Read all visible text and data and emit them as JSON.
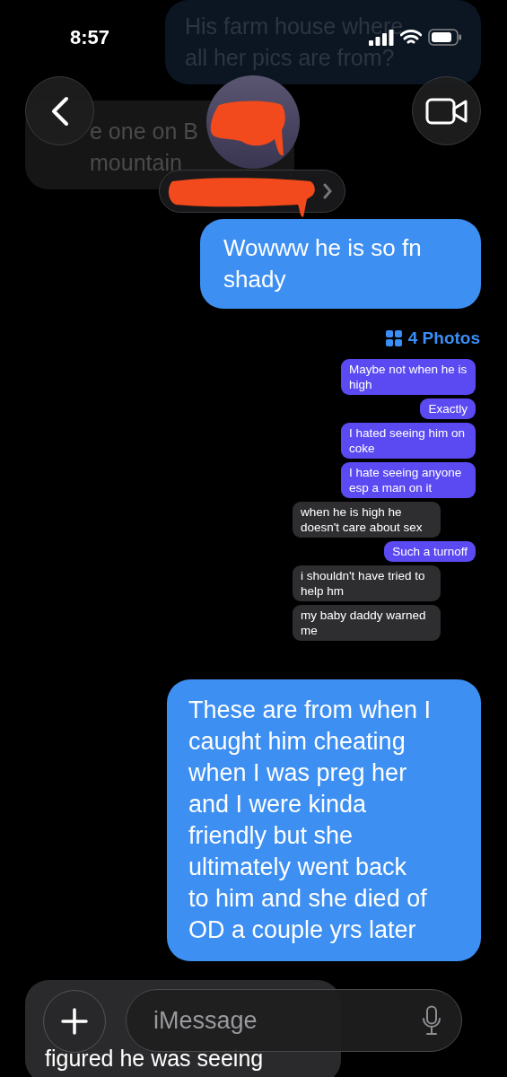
{
  "status_bar": {
    "time": "8:57"
  },
  "messages": [
    {
      "kind": "text",
      "outgoing": true,
      "dimmed": true,
      "lines": [
        "His farm house where",
        "all her pics are from?"
      ]
    },
    {
      "kind": "text",
      "outgoing": false,
      "dimmed": true,
      "lines": [
        "e one on B",
        "mountain"
      ]
    },
    {
      "kind": "text",
      "outgoing": true,
      "dimmed": false,
      "lines": [
        "Wowww he is so fn",
        "shady"
      ]
    },
    {
      "kind": "photos",
      "label": "4 Photos",
      "messages": [
        {
          "outgoing": true,
          "text": "Maybe not when he is high"
        },
        {
          "outgoing": true,
          "text": "Exactly"
        },
        {
          "outgoing": true,
          "text": "I hated seeing him on coke"
        },
        {
          "outgoing": true,
          "text": "I hate seeing anyone esp a man on it"
        },
        {
          "outgoing": false,
          "text": "when he is high he doesn't care about sex"
        },
        {
          "outgoing": true,
          "text": "Such a turnoff"
        },
        {
          "outgoing": false,
          "text": "i shouldn't have tried to help hm"
        },
        {
          "outgoing": false,
          "text": "my baby daddy warned me"
        }
      ]
    },
    {
      "kind": "text",
      "outgoing": true,
      "dimmed": false,
      "lines": [
        "These are from when I",
        "caught him cheating",
        "when I was preg her",
        "and I were kinda",
        "friendly but she",
        "ultimately went back",
        "to him and she died of",
        "OD a couple yrs later"
      ]
    },
    {
      "kind": "text",
      "outgoing": false,
      "dimmed": false,
      "lines": [
        "figured he was seeing"
      ]
    }
  ],
  "composer": {
    "placeholder": "iMessage"
  }
}
